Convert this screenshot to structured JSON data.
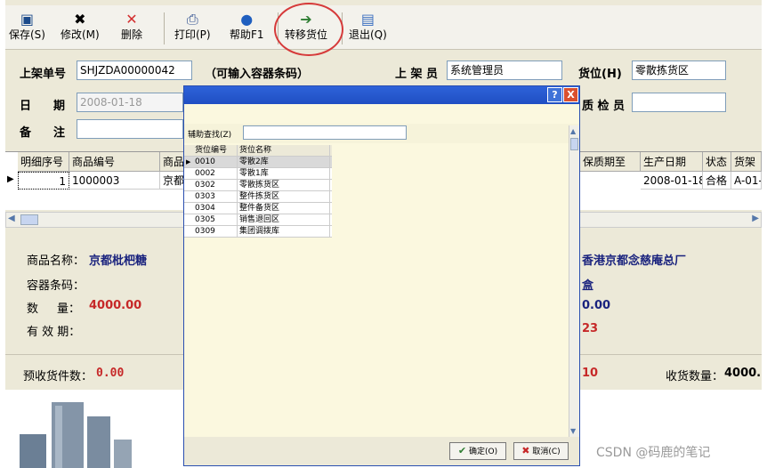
{
  "toolbar": {
    "save": "保存(S)",
    "edit": "修改(M)",
    "delete": "删除",
    "print": "打印(P)",
    "help": "帮助F1",
    "transfer": "转移货位",
    "exit": "退出(Q)"
  },
  "form": {
    "shelf_no_label": "上架单号",
    "shelf_no_value": "SHJZDA00000042",
    "container_hint": "（可输入容器条码）",
    "shelver_label": "上 架 员",
    "shelver_value": "系统管理员",
    "location_label": "货位(H)",
    "location_value": "零散拣货区",
    "date_label_1": "日",
    "date_label_2": "期",
    "date_value": "2008-01-18",
    "qc_label": "质 检 员",
    "qc_value": "",
    "note_label_1": "备",
    "note_label_2": "注",
    "note_value": ""
  },
  "grid": {
    "headers": [
      "明细序号",
      "商品编号",
      "商品",
      "保质期至",
      "生产日期",
      "状态",
      "货架"
    ],
    "row": {
      "seq": "1",
      "code": "1000003",
      "name": "京都",
      "prod_date": "2008-01-18",
      "status": "合格",
      "shelf": "A-01-"
    }
  },
  "detail": {
    "product_name_label": "商品名称：",
    "product_name_value": "京都枇杷糖",
    "container_label": "容器条码：",
    "qty_label_1": "数",
    "qty_label_2": "量：",
    "qty_value": "4000.00",
    "expiry_label": "有 效 期：",
    "manufacturer_value": "香港京都念慈庵总厂",
    "unit_value": "盒",
    "right_qty": "0.00",
    "right_num": "23",
    "precount_label": "预收货件数：",
    "precount_value": "0.00",
    "right_count": "10",
    "received_label": "收货数量：",
    "received_value": "4000."
  },
  "dialog": {
    "help_btn": "?",
    "close_btn": "X",
    "search_label": "辅助查找(Z)",
    "search_value": "",
    "col_code": "货位编号",
    "col_name": "货位名称",
    "rows": [
      {
        "code": "0010",
        "name": "零散2库"
      },
      {
        "code": "0002",
        "name": "零散1库"
      },
      {
        "code": "0302",
        "name": "零散拣货区"
      },
      {
        "code": "0303",
        "name": "整件拣货区"
      },
      {
        "code": "0304",
        "name": "整件备货区"
      },
      {
        "code": "0305",
        "name": "销售退回区"
      },
      {
        "code": "0309",
        "name": "集团调拨库"
      }
    ],
    "ok": "确定(O)",
    "cancel": "取消(C)"
  },
  "watermark": "CSDN @码鹿的笔记"
}
